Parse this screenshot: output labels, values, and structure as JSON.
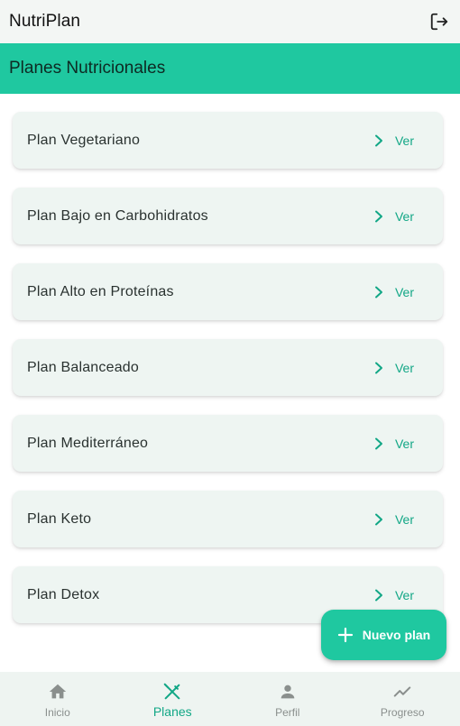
{
  "app": {
    "title": "NutriPlan"
  },
  "header": {
    "title": "Planes Nutricionales"
  },
  "plans": [
    {
      "name": "Plan Vegetariano",
      "action": "Ver"
    },
    {
      "name": "Plan Bajo en Carbohidratos",
      "action": "Ver"
    },
    {
      "name": "Plan Alto en Proteínas",
      "action": "Ver"
    },
    {
      "name": "Plan Balanceado",
      "action": "Ver"
    },
    {
      "name": "Plan Mediterráneo",
      "action": "Ver"
    },
    {
      "name": "Plan Keto",
      "action": "Ver"
    },
    {
      "name": "Plan Detox",
      "action": "Ver"
    }
  ],
  "fab": {
    "label": "Nuevo plan",
    "icon": "plus-icon"
  },
  "nav": {
    "active": "Planes",
    "items": [
      {
        "label": "Inicio",
        "icon": "home-icon"
      },
      {
        "label": "Planes",
        "icon": "utensils-icon"
      },
      {
        "label": "Perfil",
        "icon": "person-icon"
      },
      {
        "label": "Progreso",
        "icon": "trending-up-icon"
      }
    ]
  },
  "colors": {
    "accent": "#1fc8a0",
    "accent_text": "#12a786",
    "card_bg": "#eef5f2",
    "appbar_bg": "#f3f6f4",
    "nav_bg": "#eef4f1",
    "inactive": "#8a8f8d"
  }
}
